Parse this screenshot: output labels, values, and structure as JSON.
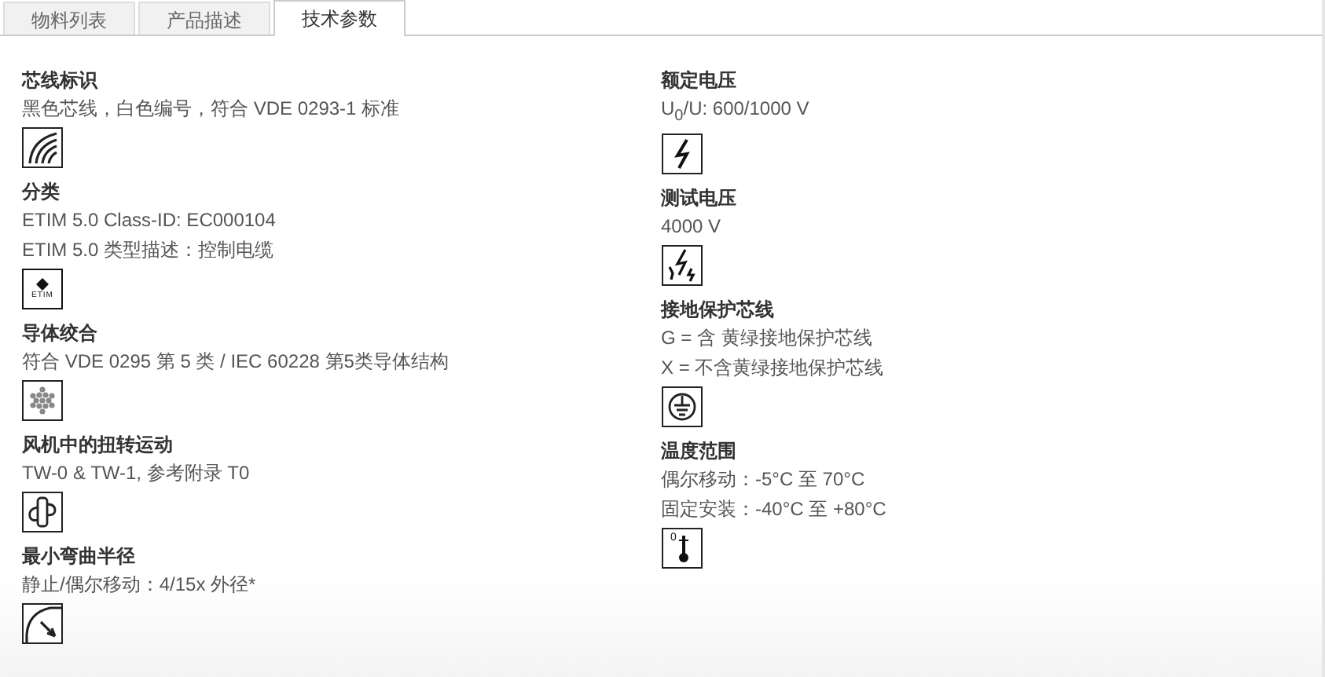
{
  "tabs": [
    {
      "label": "物料列表",
      "selected": false
    },
    {
      "label": "产品描述",
      "selected": false
    },
    {
      "label": "技术参数",
      "selected": true
    }
  ],
  "columns": [
    {
      "sections": [
        {
          "title": "芯线标识",
          "lines": [
            "黑色芯线，白色编号，符合 VDE 0293-1 标准"
          ],
          "icon": {
            "kind": "core-marking"
          }
        },
        {
          "title": "分类",
          "lines": [
            "ETIM 5.0 Class-ID: EC000104",
            "ETIM 5.0 类型描述：控制电缆"
          ],
          "icon": {
            "kind": "etim",
            "label": "ETIM"
          }
        },
        {
          "title": "导体绞合",
          "lines": [
            "符合 VDE 0295 第 5 类 / IEC 60228 第5类导体结构"
          ],
          "icon": {
            "kind": "strands"
          }
        },
        {
          "title": "风机中的扭转运动",
          "lines": [
            "TW-0 & TW-1, 参考附录 T0"
          ],
          "icon": {
            "kind": "torsion"
          }
        },
        {
          "title": "最小弯曲半径",
          "lines": [
            "静止/偶尔移动：4/15x 外径*"
          ],
          "icon": {
            "kind": "bend"
          }
        }
      ]
    },
    {
      "sections": [
        {
          "title": "额定电压",
          "lines": [
            "U$_{0}$/U: 600/1000 V"
          ],
          "icon": {
            "kind": "voltage"
          }
        },
        {
          "title": "测试电压",
          "lines": [
            "4000 V"
          ],
          "icon": {
            "kind": "test-voltage"
          }
        },
        {
          "title": "接地保护芯线",
          "lines": [
            "G = 含 黄绿接地保护芯线",
            "X = 不含黄绿接地保护芯线"
          ],
          "icon": {
            "kind": "ground"
          }
        },
        {
          "title": "温度范围",
          "lines": [
            "偶尔移动：-5°C 至 70°C",
            "固定安装：-40°C 至 +80°C"
          ],
          "icon": {
            "kind": "thermometer",
            "label": "0"
          }
        }
      ]
    }
  ]
}
